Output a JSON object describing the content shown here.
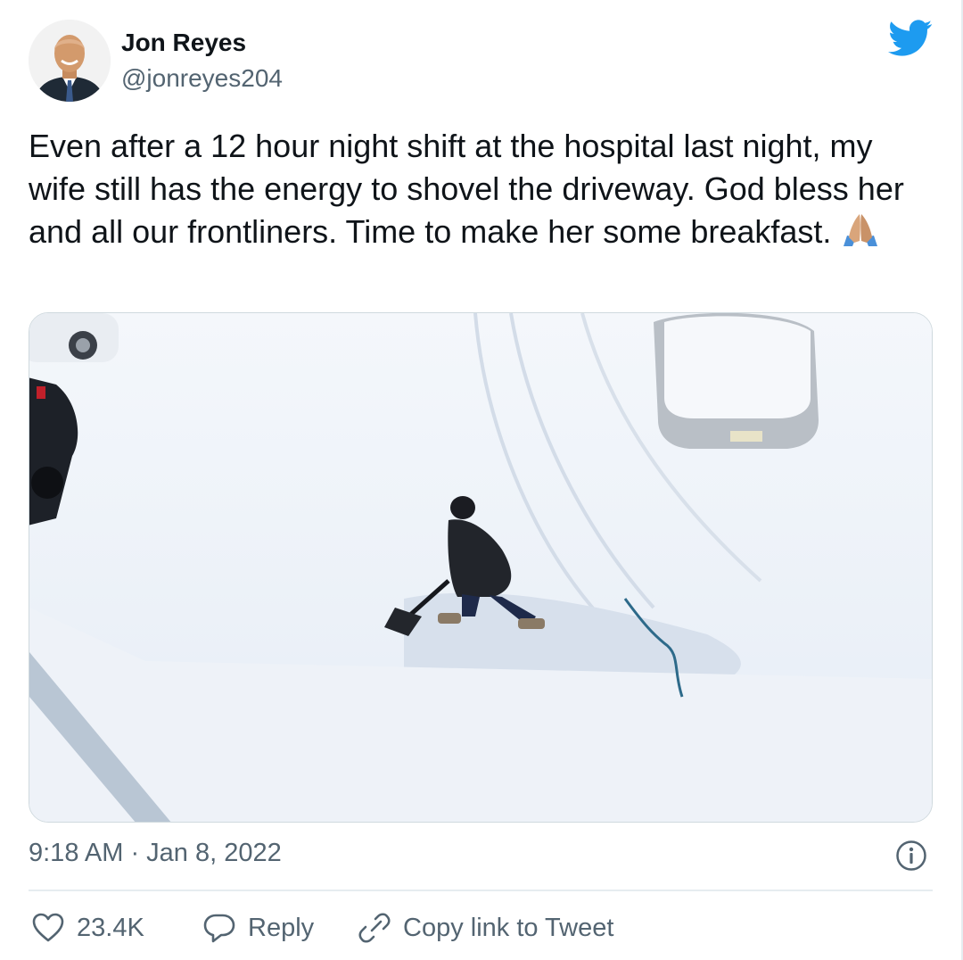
{
  "tweet": {
    "author": {
      "display_name": "Jon Reyes",
      "handle": "@jonreyes204",
      "avatar_icon": "profile-photo"
    },
    "platform_icon": "twitter-bird-icon",
    "text": "Even after a 12 hour night shift at the hospital last night, my wife still has the energy to shovel the driveway. God bless her and all our frontliners. Time to make her some breakfast.",
    "emoji": "folded-hands-emoji",
    "media": {
      "type": "photo",
      "alt_icon": "snow-driveway-photo"
    },
    "timestamp": "9:18 AM · Jan 8, 2022",
    "actions": {
      "like_count": "23.4K",
      "reply_label": "Reply",
      "copy_link_label": "Copy link to Tweet"
    }
  },
  "colors": {
    "brand": "#1d9bf0",
    "text_primary": "#0f1419",
    "text_secondary": "#536471",
    "divider": "#e6ecf0"
  }
}
